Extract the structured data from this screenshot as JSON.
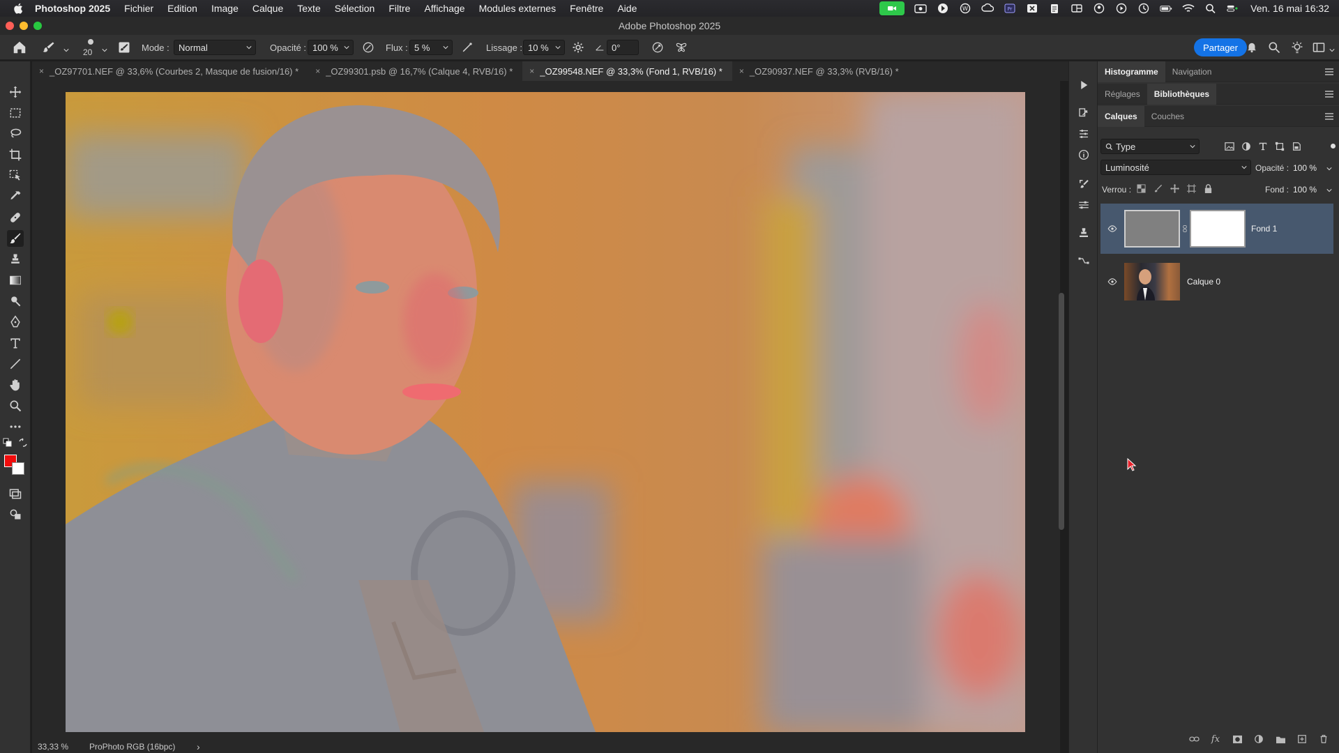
{
  "menubar": {
    "app_name": "Photoshop 2025",
    "items": [
      "Fichier",
      "Edition",
      "Image",
      "Calque",
      "Texte",
      "Sélection",
      "Filtre",
      "Affichage",
      "Modules externes",
      "Fenêtre",
      "Aide"
    ],
    "clock": "Ven. 16 mai  16:32"
  },
  "window": {
    "title": "Adobe Photoshop 2025"
  },
  "options": {
    "brush_size": "20",
    "mode_label": "Mode :",
    "mode_value": "Normal",
    "opacity_label": "Opacité :",
    "opacity_value": "100 %",
    "flow_label": "Flux :",
    "flow_value": "5 %",
    "smoothing_label": "Lissage :",
    "smoothing_value": "10 %",
    "angle_value": "0°",
    "share_label": "Partager"
  },
  "tabs": [
    {
      "label": "_OZ97701.NEF @ 33,6% (Courbes 2, Masque de fusion/16) *"
    },
    {
      "label": "_OZ99301.psb @ 16,7% (Calque 4, RVB/16) *"
    },
    {
      "label": "_OZ99548.NEF @ 33,3% (Fond 1, RVB/16) *"
    },
    {
      "label": "_OZ90937.NEF @ 33,3% (RVB/16) *"
    }
  ],
  "status": {
    "zoom": "33,33 %",
    "profile": "ProPhoto RGB (16bpc)",
    "arrow": "›"
  },
  "panels": {
    "group1": [
      "Histogramme",
      "Navigation"
    ],
    "group2": [
      "Réglages",
      "Bibliothèques"
    ],
    "group3": [
      "Calques",
      "Couches"
    ],
    "filter_label": "Type",
    "blend_mode": "Luminosité",
    "opacity_label": "Opacité :",
    "opacity_value": "100 %",
    "lock_label": "Verrou :",
    "fill_label": "Fond :",
    "fill_value": "100 %",
    "layers": [
      {
        "name": "Fond 1"
      },
      {
        "name": "Calque 0"
      }
    ]
  },
  "colors": {
    "foreground": "#f00c0c",
    "background": "#ffffff",
    "accent": "#1473e6",
    "selected_layer": "#47586e"
  }
}
